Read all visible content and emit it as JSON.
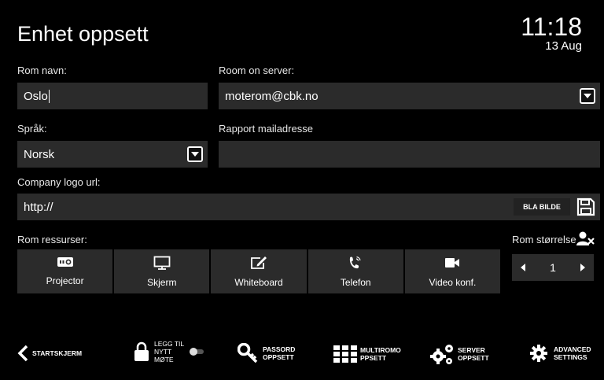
{
  "header": {
    "title": "Enhet oppsett",
    "time": "11:18",
    "date": "13 Aug"
  },
  "form": {
    "room_name_label": "Rom navn:",
    "room_name_value": "Oslo",
    "room_server_label": "Room on server:",
    "room_server_value": "moterom@cbk.no",
    "language_label": "Språk:",
    "language_value": "Norsk",
    "report_label": "Rapport mailadresse",
    "report_value": "",
    "logo_label": "Company logo url:",
    "logo_value": "http://",
    "browse_label": "BLA BILDE"
  },
  "resources": {
    "label": "Rom ressurser:",
    "items": [
      "Projector",
      "Skjerm",
      "Whiteboard",
      "Telefon",
      "Video konf."
    ]
  },
  "room_size": {
    "label": "Rom størrelse",
    "value": "1"
  },
  "bottom_nav": {
    "back": "STARTSKJERM",
    "lock": [
      "LEGG TIL",
      "NYTT",
      "MØTE"
    ],
    "password": [
      "PASSORD",
      "OPPSETT"
    ],
    "multiroom": [
      "MULTIROMO",
      "PPSETT"
    ],
    "server": [
      "SERVER",
      "OPPSETT"
    ],
    "advanced": [
      "ADVANCED",
      "SETTINGS"
    ]
  },
  "icons": [
    "projector-icon",
    "monitor-icon",
    "whiteboard-icon",
    "phone-icon",
    "video-camera-icon",
    "save-icon",
    "user-remove-icon",
    "chevron-left-icon",
    "chevron-right-icon",
    "back-arrow-icon",
    "lock-icon",
    "toggle-icon",
    "key-icon",
    "grid-icon",
    "gears-icon",
    "gear-icon"
  ]
}
